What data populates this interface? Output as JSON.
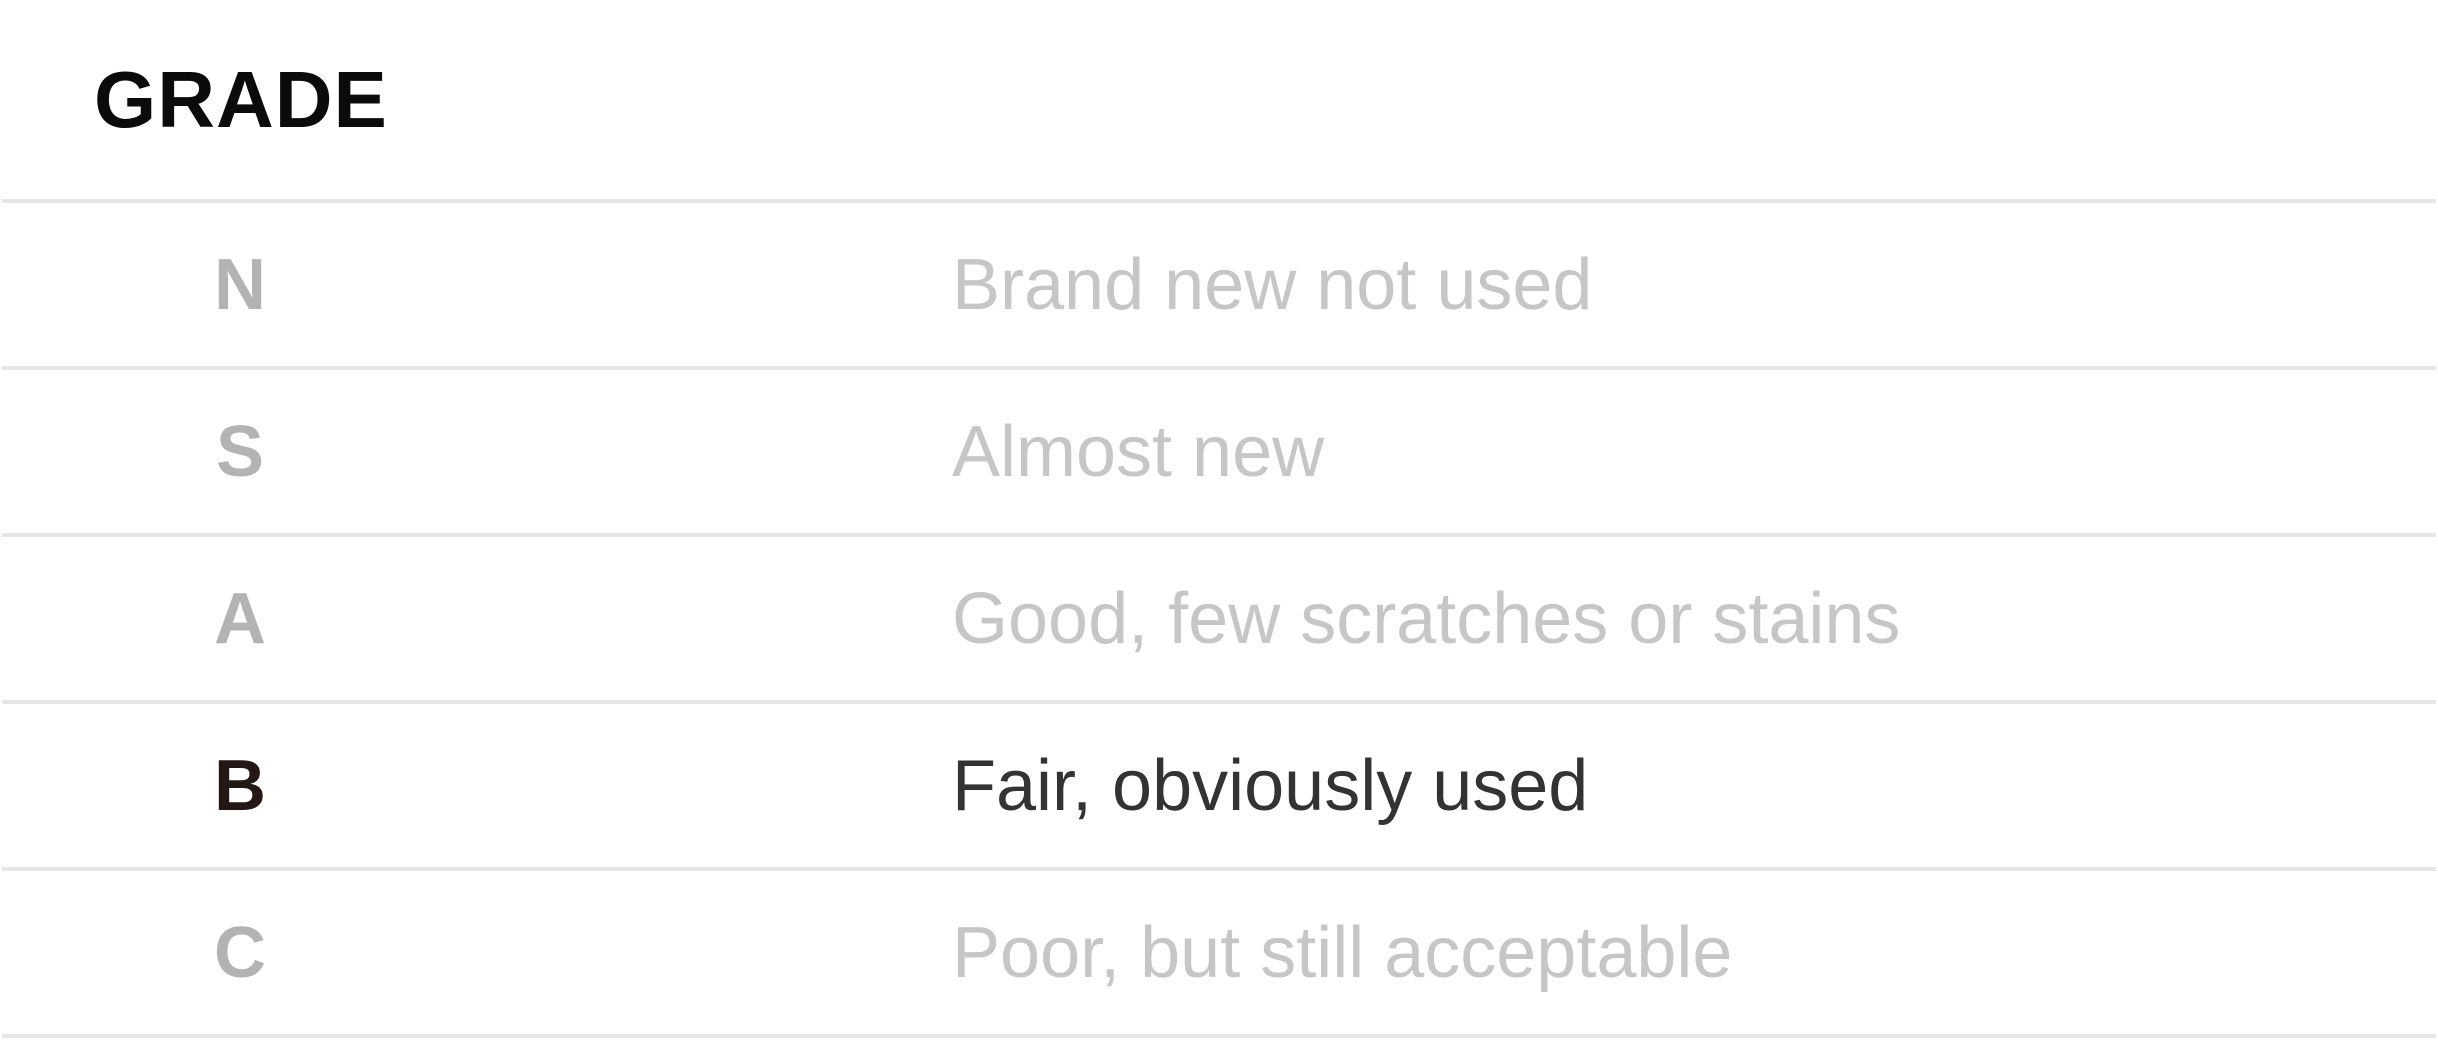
{
  "title": "GRADE",
  "selected": "B",
  "grades": [
    {
      "letter": "N",
      "description": "Brand new not used"
    },
    {
      "letter": "S",
      "description": "Almost new"
    },
    {
      "letter": "A",
      "description": "Good, few scratches or stains"
    },
    {
      "letter": "B",
      "description": "Fair, obviously used"
    },
    {
      "letter": "C",
      "description": "Poor, but still acceptable"
    }
  ],
  "colors": {
    "title": "#0b0b0b",
    "inactive_letter": "#b3b3b3",
    "inactive_text": "#c6c6c6",
    "active_letter": "#231815",
    "active_text": "#333333",
    "divider": "#e6e6e6"
  }
}
